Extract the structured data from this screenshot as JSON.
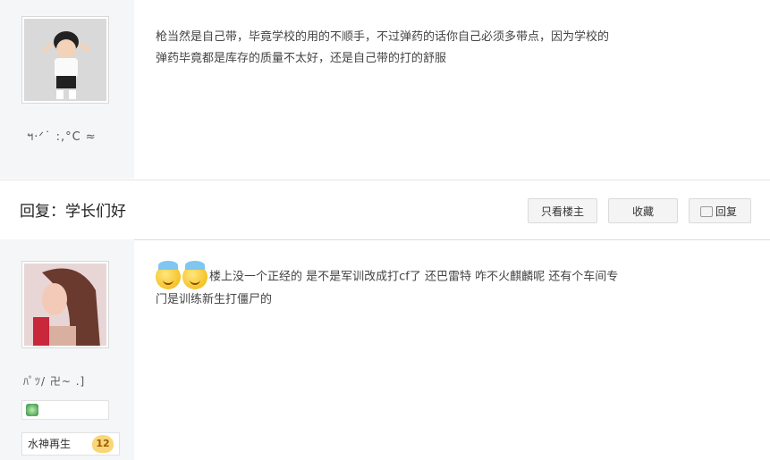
{
  "post1": {
    "username": "ฯ·ᐟ˙ :,°C ≈",
    "text_line1": "枪当然是自己带，毕竟学校的用的不顺手，不过弹药的话你自己必须多带点，因为学校的",
    "text_line2": "弹药毕竟都是库存的质量不太好，还是自己带的打的舒服"
  },
  "reply_bar": {
    "title": "回复：学长们好",
    "only_op_label": "只看楼主",
    "favorite_label": "收藏",
    "reply_label": "回复"
  },
  "post2": {
    "username": "ﾊﾟﾂ/ 卍~ .]",
    "text_line1": "楼上没一个正经的 是不是军训改成打cf了 还巴雷特 咋不火麒麟呢 还有个车间专",
    "text_line2": "门是训练新生打僵尸的",
    "tag_label": "水神再生",
    "level": "12"
  },
  "colors": {
    "sidebar_bg": "#f5f6f8",
    "border": "#dcdcdc",
    "level_badge": "#f7d77a"
  }
}
